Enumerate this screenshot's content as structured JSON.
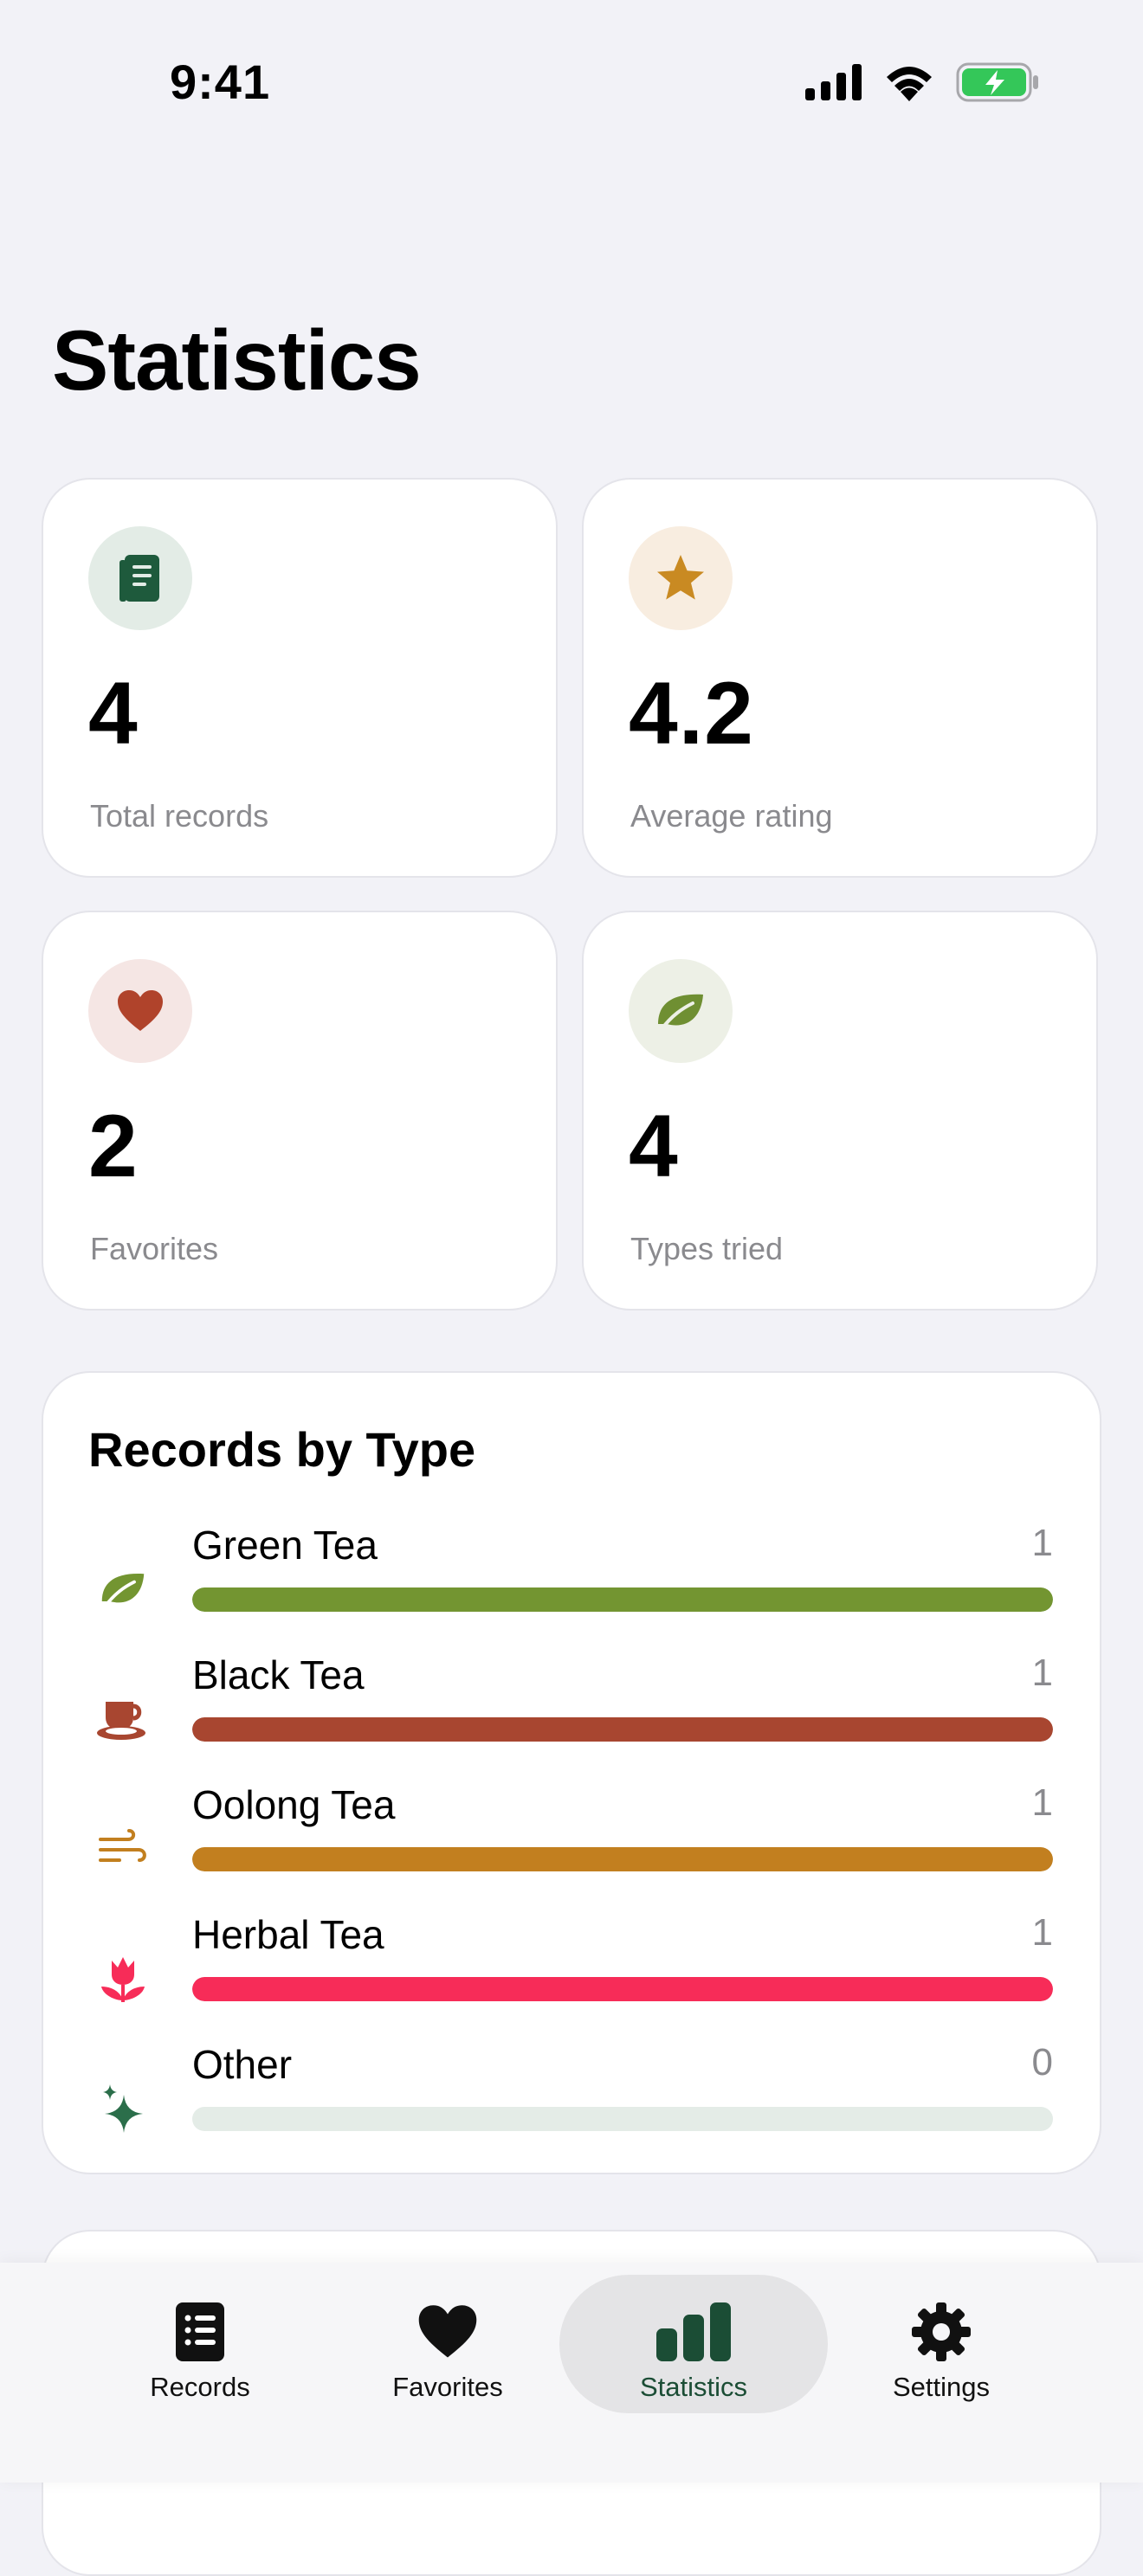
{
  "status_bar": {
    "time": "9:41"
  },
  "page": {
    "title": "Statistics"
  },
  "stats": [
    {
      "value": "4",
      "label": "Total records",
      "icon": "book-icon",
      "icon_color": "#1e5a3c",
      "icon_bg": "#e3ece6"
    },
    {
      "value": "4.2",
      "label": "Average rating",
      "icon": "star-icon",
      "icon_color": "#c98a22",
      "icon_bg": "#f8ede0"
    },
    {
      "value": "2",
      "label": "Favorites",
      "icon": "heart-icon",
      "icon_color": "#b0432b",
      "icon_bg": "#f5e6e4"
    },
    {
      "value": "4",
      "label": "Types tried",
      "icon": "leaf-icon",
      "icon_color": "#6f8f32",
      "icon_bg": "#edf0e6"
    }
  ],
  "records_by_type": {
    "title": "Records by Type",
    "items": [
      {
        "name": "Green Tea",
        "count": "1",
        "fraction": 1,
        "color": "#739531",
        "icon": "leaf-icon"
      },
      {
        "name": "Black Tea",
        "count": "1",
        "fraction": 1,
        "color": "#a84630",
        "icon": "teacup-icon"
      },
      {
        "name": "Oolong Tea",
        "count": "1",
        "fraction": 1,
        "color": "#c27f1f",
        "icon": "wind-icon"
      },
      {
        "name": "Herbal Tea",
        "count": "1",
        "fraction": 1,
        "color": "#f72c58",
        "icon": "flower-icon"
      },
      {
        "name": "Other",
        "count": "0",
        "fraction": 0,
        "color": "#2b6e4a",
        "icon": "sparkles-icon"
      }
    ]
  },
  "tab_bar": {
    "tabs": [
      {
        "label": "Records",
        "icon": "list-icon",
        "active": false
      },
      {
        "label": "Favorites",
        "icon": "heart-icon",
        "active": false
      },
      {
        "label": "Statistics",
        "icon": "chart-bars-icon",
        "active": true
      },
      {
        "label": "Settings",
        "icon": "gear-icon",
        "active": false
      }
    ]
  },
  "colors": {
    "accent": "#1b4d35",
    "background": "#f2f2f7",
    "battery": "#34c759"
  }
}
